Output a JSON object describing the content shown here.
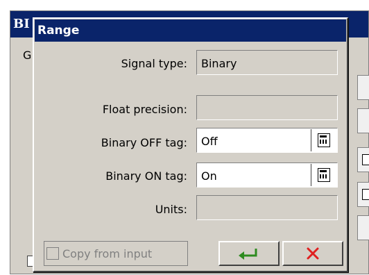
{
  "background_window": {
    "title": "BI",
    "tab_label": "G"
  },
  "dialog": {
    "title": "Range",
    "fields": [
      {
        "label": "Signal type:",
        "value": "Binary",
        "editable": false,
        "has_picker": false
      },
      {
        "label": "Float precision:",
        "value": "",
        "editable": false,
        "has_picker": false
      },
      {
        "label": "Binary OFF tag:",
        "value": "Off",
        "editable": true,
        "has_picker": true
      },
      {
        "label": "Binary ON tag:",
        "value": "On",
        "editable": true,
        "has_picker": true
      },
      {
        "label": "Units:",
        "value": "",
        "editable": false,
        "has_picker": false
      }
    ],
    "copy_checkbox": {
      "label": "Copy from input",
      "checked": false,
      "enabled": false
    },
    "buttons": {
      "ok_icon": "enter-arrow-icon",
      "cancel_icon": "red-x-icon"
    }
  },
  "colors": {
    "title_bar": "#0a246a",
    "dialog_face": "#d4d0c8",
    "ok_arrow": "#2e8b20",
    "cancel_x": "#e02020"
  }
}
